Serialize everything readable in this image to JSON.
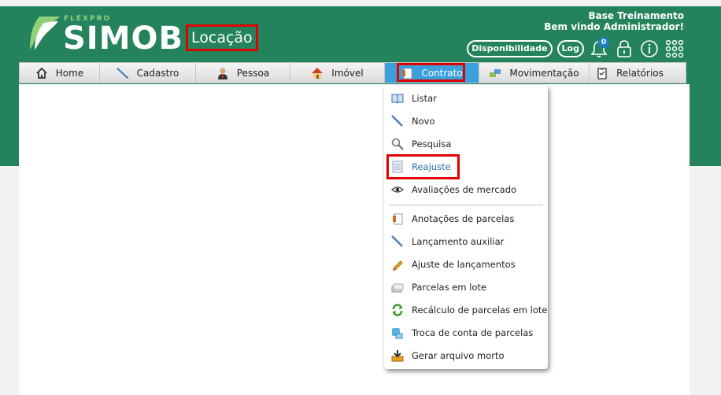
{
  "brand": {
    "small": "FLEXPRO",
    "name": "SIMOB",
    "module": "Locação"
  },
  "user": {
    "company": "Base Treinamento",
    "greeting": "Bem vindo Administrador!"
  },
  "tools": {
    "availability": "Disponibilidade",
    "log": "Log",
    "notifications_count": "0"
  },
  "menu": [
    {
      "label": "Home",
      "icon": "home-icon"
    },
    {
      "label": "Cadastro",
      "icon": "quill-icon"
    },
    {
      "label": "Pessoa",
      "icon": "person-icon"
    },
    {
      "label": "Imóvel",
      "icon": "house-icon"
    },
    {
      "label": "Contrato",
      "icon": "contract-icon",
      "active": true
    },
    {
      "label": "Movimentação",
      "icon": "transfer-icon"
    },
    {
      "label": "Relatórios",
      "icon": "clipboard-icon"
    }
  ],
  "dropdown": [
    {
      "label": "Listar",
      "icon": "book-icon"
    },
    {
      "label": "Novo",
      "icon": "quill-icon"
    },
    {
      "label": "Pesquisa",
      "icon": "magnifier-icon"
    },
    {
      "label": "Reajuste",
      "icon": "document-icon"
    },
    {
      "label": "Avaliações de mercado",
      "icon": "eye-icon"
    },
    {
      "label": "Anotações de parcelas",
      "icon": "notes-icon"
    },
    {
      "label": "Lançamento auxiliar",
      "icon": "quill-icon"
    },
    {
      "label": "Ajuste de lançamentos",
      "icon": "pencil-icon"
    },
    {
      "label": "Parcelas em lote",
      "icon": "stack-icon"
    },
    {
      "label": "Recálculo de parcelas em lote",
      "icon": "recycle-icon"
    },
    {
      "label": "Troca de conta de parcelas",
      "icon": "swap-icon"
    },
    {
      "label": "Gerar arquivo morto",
      "icon": "archive-download-icon"
    }
  ],
  "colors": {
    "header": "#24835d",
    "active_tab": "#3aa0dc",
    "highlight_box": "#e00000"
  }
}
